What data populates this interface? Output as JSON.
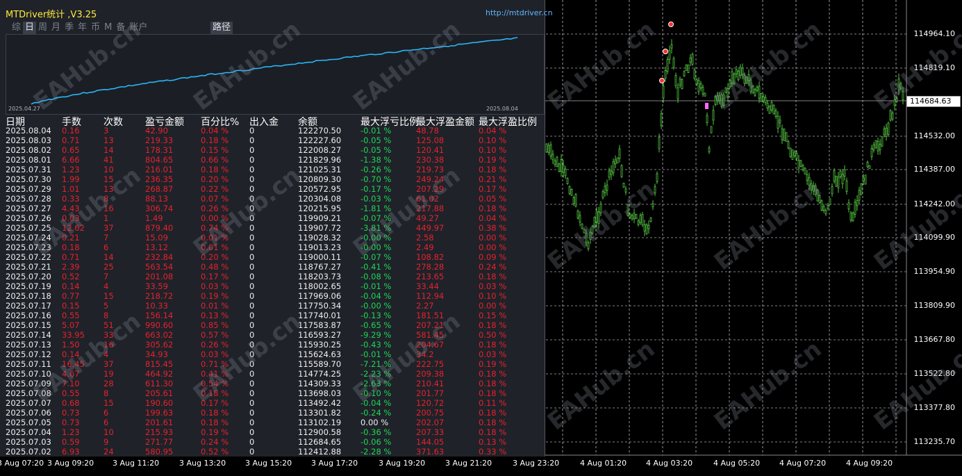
{
  "chart": {
    "price_axis": [
      "114964.10",
      "114819.10",
      "114532.00",
      "114387.00",
      "114242.00",
      "114099.90",
      "113954.90",
      "113809.90",
      "113667.80",
      "113522.80",
      "113377.80",
      "113235.70"
    ],
    "current_price": "114684.63",
    "time_axis": [
      "3 Aug 07:20",
      "3 Aug 09:20",
      "3 Aug 11:20",
      "3 Aug 13:20",
      "3 Aug 15:20",
      "3 Aug 17:20",
      "3 Aug 19:20",
      "3 Aug 21:20",
      "3 Aug 23:20",
      "4 Aug 01:20",
      "4 Aug 03:20",
      "4 Aug 05:20",
      "4 Aug 07:20",
      "4 Aug 09:20"
    ],
    "colors": {
      "background": "#000000",
      "grid": "#ffffff",
      "candles": "#55c642",
      "axis_text": "#ffffff"
    }
  },
  "panel": {
    "title": "MTDriver统计 ,V3.25",
    "url": "http://mtdriver.cn",
    "tabs": [
      "综",
      "日",
      "周",
      "月",
      "季",
      "年",
      "币",
      "M",
      "备",
      "账户"
    ],
    "active_tab": "日",
    "route_tab": "路径",
    "mini_chart": {
      "start_date": "2025.04.27",
      "end_date": "2025.08.04",
      "line_color": "#29b6f6"
    },
    "columns": [
      "日期",
      "手数",
      "次数",
      "盈亏金额",
      "百分比%",
      "出入金",
      "余额",
      "最大浮亏比例",
      "最大浮盈金额",
      "最大浮盈比例"
    ],
    "rows": [
      [
        "2025.08.04",
        "0.16",
        "3",
        "42.90",
        "0.04 %",
        "0",
        "122270.50",
        "-0.01 %",
        "48.78",
        "0.04 %"
      ],
      [
        "2025.08.03",
        "0.71",
        "13",
        "219.33",
        "0.18 %",
        "0",
        "122227.60",
        "-0.05 %",
        "125.08",
        "0.10 %"
      ],
      [
        "2025.08.02",
        "0.65",
        "14",
        "178.31",
        "0.15 %",
        "0",
        "122008.27",
        "-0.05 %",
        "120.41",
        "0.10 %"
      ],
      [
        "2025.08.01",
        "6.66",
        "41",
        "804.65",
        "0.66 %",
        "0",
        "121829.96",
        "-1.38 %",
        "230.38",
        "0.19 %"
      ],
      [
        "2025.07.31",
        "1.23",
        "10",
        "216.01",
        "0.18 %",
        "0",
        "121025.31",
        "-0.26 %",
        "219.73",
        "0.18 %"
      ],
      [
        "2025.07.30",
        "1.99",
        "15",
        "236.35",
        "0.20 %",
        "0",
        "120809.30",
        "-0.70 %",
        "249.24",
        "0.21 %"
      ],
      [
        "2025.07.29",
        "1.01",
        "13",
        "268.87",
        "0.22 %",
        "0",
        "120572.95",
        "-0.17 %",
        "207.29",
        "0.17 %"
      ],
      [
        "2025.07.28",
        "0.33",
        "8",
        "88.13",
        "0.07 %",
        "0",
        "120304.08",
        "-0.03 %",
        "61.02",
        "0.05 %"
      ],
      [
        "2025.07.27",
        "4.43",
        "16",
        "306.74",
        "0.26 %",
        "0",
        "120215.95",
        "-1.81 %",
        "217.88",
        "0.18 %"
      ],
      [
        "2025.07.26",
        "0.03",
        "1",
        "1.49",
        "0.00 %",
        "0",
        "119909.21",
        "-0.07 %",
        "49.27",
        "0.04 %"
      ],
      [
        "2025.07.25",
        "12.62",
        "37",
        "879.40",
        "0.74 %",
        "0",
        "119907.72",
        "-3.81 %",
        "449.97",
        "0.38 %"
      ],
      [
        "2025.07.24",
        "0.21",
        "7",
        "15.09",
        "0.01 %",
        "0",
        "119028.32",
        "-0.00 %",
        "2.58",
        "0.00 %"
      ],
      [
        "2025.07.23",
        "0.18",
        "6",
        "13.12",
        "0.01 %",
        "0",
        "119013.23",
        "-0.00 %",
        "2.49",
        "0.00 %"
      ],
      [
        "2025.07.22",
        "0.71",
        "14",
        "232.84",
        "0.20 %",
        "0",
        "119000.11",
        "-0.07 %",
        "108.82",
        "0.09 %"
      ],
      [
        "2025.07.21",
        "2.39",
        "25",
        "563.54",
        "0.48 %",
        "0",
        "118767.27",
        "-0.41 %",
        "278.28",
        "0.24 %"
      ],
      [
        "2025.07.20",
        "0.52",
        "7",
        "201.08",
        "0.17 %",
        "0",
        "118203.73",
        "-0.08 %",
        "213.65",
        "0.18 %"
      ],
      [
        "2025.07.19",
        "0.14",
        "4",
        "33.59",
        "0.03 %",
        "0",
        "118002.65",
        "-0.01 %",
        "33.44",
        "0.03 %"
      ],
      [
        "2025.07.18",
        "0.77",
        "15",
        "218.72",
        "0.19 %",
        "0",
        "117969.06",
        "-0.04 %",
        "112.94",
        "0.10 %"
      ],
      [
        "2025.07.17",
        "0.15",
        "5",
        "10.33",
        "0.01 %",
        "0",
        "117750.34",
        "-0.00 %",
        "2.27",
        "0.00 %"
      ],
      [
        "2025.07.16",
        "0.55",
        "8",
        "156.14",
        "0.13 %",
        "0",
        "117740.01",
        "-0.13 %",
        "181.51",
        "0.15 %"
      ],
      [
        "2025.07.15",
        "5.07",
        "51",
        "990.60",
        "0.85 %",
        "0",
        "117583.87",
        "-0.65 %",
        "207.21",
        "0.18 %"
      ],
      [
        "2025.07.14",
        "33.95",
        "33",
        "663.02",
        "0.57 %",
        "0",
        "116593.27",
        "-9.29 %",
        "581.45",
        "0.50 %"
      ],
      [
        "2025.07.13",
        "1.50",
        "16",
        "305.62",
        "0.26 %",
        "0",
        "115930.25",
        "-0.43 %",
        "204.67",
        "0.18 %"
      ],
      [
        "2025.07.12",
        "0.14",
        "4",
        "34.93",
        "0.03 %",
        "0",
        "115624.63",
        "-0.01 %",
        "34.2",
        "0.03 %"
      ],
      [
        "2025.07.11",
        "16.45",
        "37",
        "815.45",
        "0.71 %",
        "0",
        "115589.70",
        "-7.21 %",
        "222.75",
        "0.19 %"
      ],
      [
        "2025.07.10",
        "4.67",
        "19",
        "464.92",
        "0.41 %",
        "0",
        "114774.25",
        "-2.23 %",
        "209.38",
        "0.18 %"
      ],
      [
        "2025.07.09",
        "7.10",
        "28",
        "611.30",
        "0.54 %",
        "0",
        "114309.33",
        "-2.63 %",
        "210.41",
        "0.18 %"
      ],
      [
        "2025.07.08",
        "0.55",
        "8",
        "205.61",
        "0.18 %",
        "0",
        "113698.03",
        "-0.10 %",
        "201.77",
        "0.18 %"
      ],
      [
        "2025.07.07",
        "0.68",
        "15",
        "190.60",
        "0.17 %",
        "0",
        "113492.42",
        "-0.04 %",
        "120.72",
        "0.11 %"
      ],
      [
        "2025.07.06",
        "0.73",
        "6",
        "199.63",
        "0.18 %",
        "0",
        "113301.82",
        "-0.24 %",
        "200.75",
        "0.18 %"
      ],
      [
        "2025.07.05",
        "0.73",
        "6",
        "201.61",
        "0.18 %",
        "0",
        "113102.19",
        "0.00 %",
        "202.07",
        "0.18 %"
      ],
      [
        "2025.07.04",
        "1.23",
        "10",
        "215.93",
        "0.19 %",
        "0",
        "112900.58",
        "-0.36 %",
        "207.33",
        "0.18 %"
      ],
      [
        "2025.07.03",
        "0.59",
        "9",
        "271.77",
        "0.24 %",
        "0",
        "112684.65",
        "-0.06 %",
        "144.05",
        "0.13 %"
      ],
      [
        "2025.07.02",
        "6.93",
        "24",
        "580.95",
        "0.52 %",
        "0",
        "112412.88",
        "-2.28 %",
        "371.63",
        "0.33 %"
      ]
    ],
    "watermark": "EAHub.cn"
  }
}
